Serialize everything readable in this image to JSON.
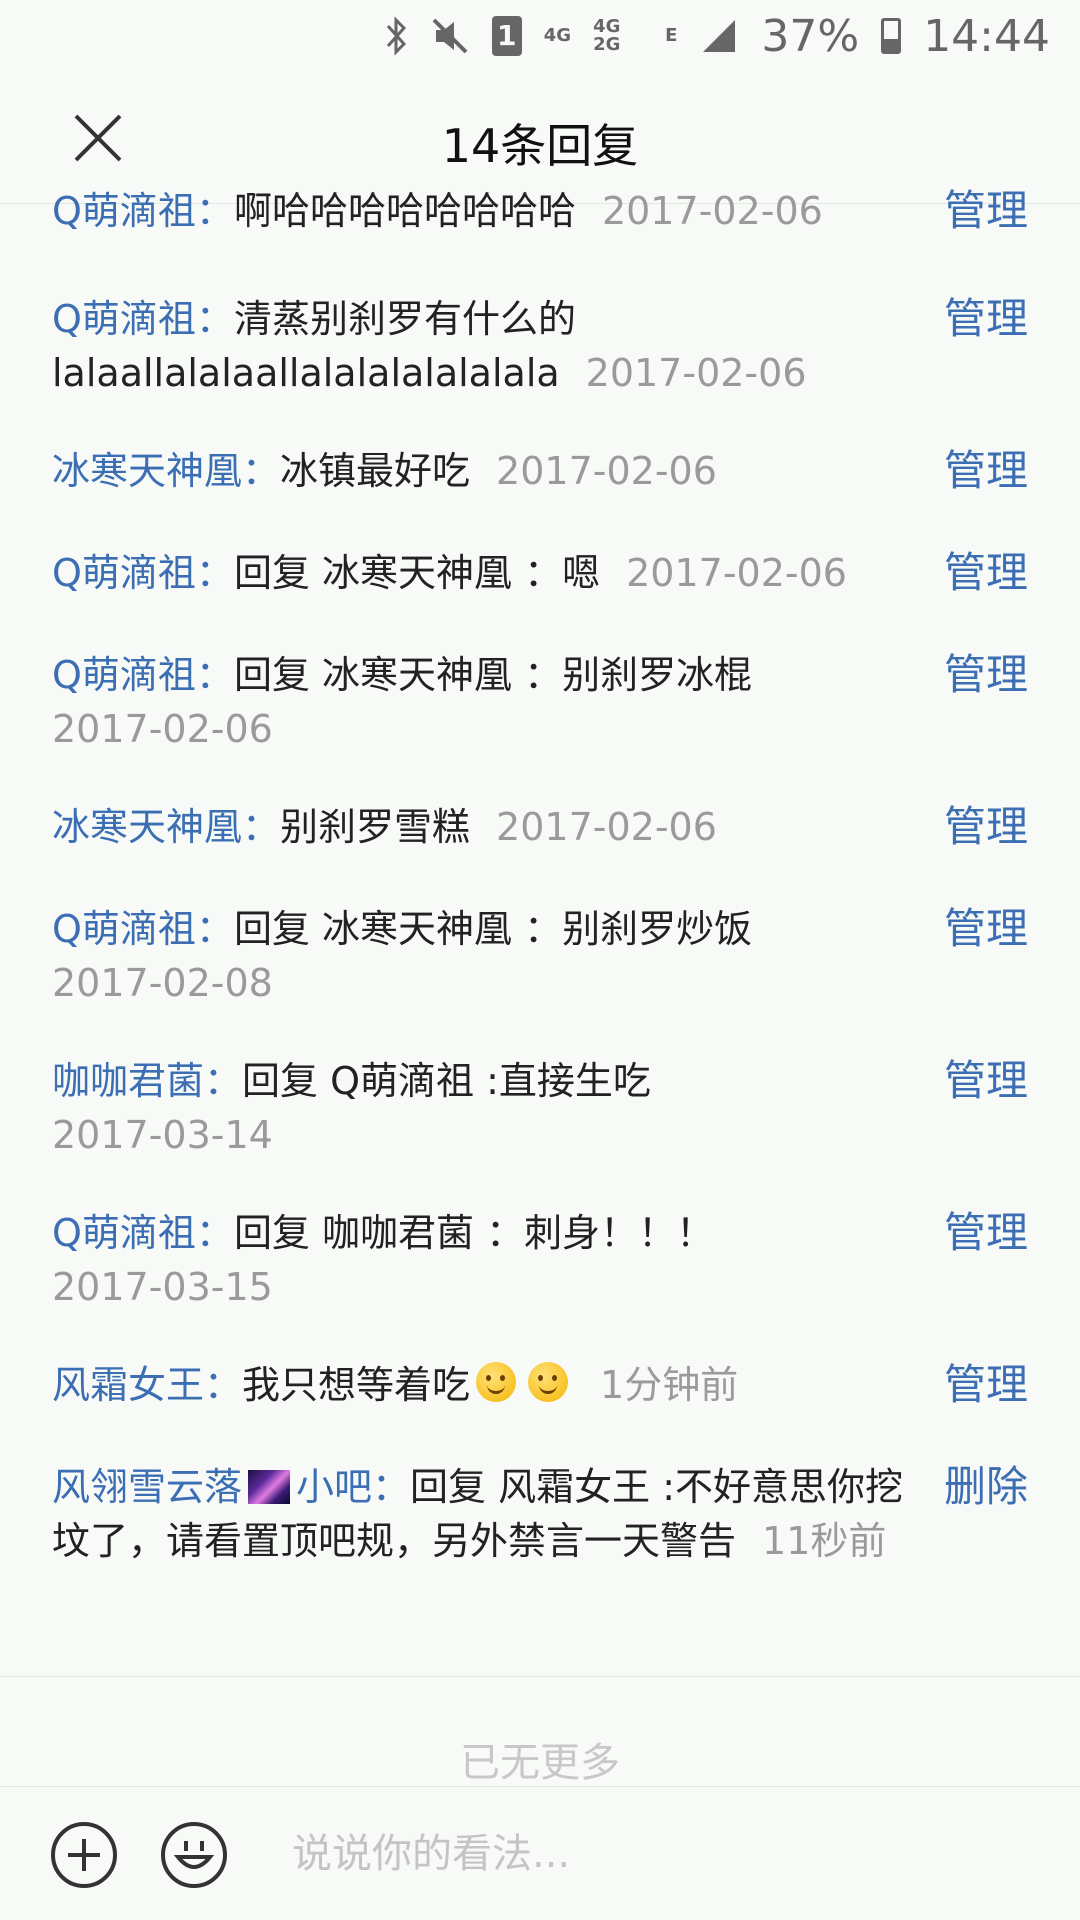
{
  "status_bar": {
    "sim_slot": "1",
    "network_a": "4G",
    "network_b": "4G 2G",
    "network_c": "E",
    "battery": "37%",
    "time": "14:44"
  },
  "header": {
    "title": "14条回复"
  },
  "replies": [
    {
      "user": "Q萌滴祖",
      "sep": "：",
      "content": "啊哈哈哈哈哈哈哈哈",
      "time": "2017-02-06",
      "action": "管理"
    },
    {
      "user": "Q萌滴祖",
      "sep": "：",
      "content": "清蒸别刹罗有什么的 lalaallalalaallalalalalalalala",
      "time": "2017-02-06",
      "action": "管理"
    },
    {
      "user": "冰寒天神凰",
      "sep": "：",
      "content": "冰镇最好吃",
      "time": "2017-02-06",
      "action": "管理"
    },
    {
      "user": "Q萌滴祖",
      "sep": "：",
      "content": "回复 冰寒天神凰 ：嗯",
      "time": "2017-02-06",
      "action": "管理"
    },
    {
      "user": "Q萌滴祖",
      "sep": "：",
      "content": "回复 冰寒天神凰 ：别刹罗冰棍",
      "time": "2017-02-06",
      "action": "管理"
    },
    {
      "user": "冰寒天神凰",
      "sep": "：",
      "content": "别刹罗雪糕",
      "time": "2017-02-06",
      "action": "管理"
    },
    {
      "user": "Q萌滴祖",
      "sep": "：",
      "content": "回复 冰寒天神凰 ：别刹罗炒饭",
      "time": "2017-02-08",
      "action": "管理"
    },
    {
      "user": "咖咖君菌",
      "sep": "：",
      "content": "回复 Q萌滴祖 :直接生吃",
      "time": "2017-03-14",
      "action": "管理"
    },
    {
      "user": "Q萌滴祖",
      "sep": "：",
      "content": "回复 咖咖君菌 ：刺身！！！",
      "time": "2017-03-15",
      "action": "管理"
    },
    {
      "user": "风霜女王",
      "sep": "：",
      "content": "我只想等着吃",
      "time": "1分钟前",
      "action": "管理"
    },
    {
      "user": "风翎雪云落",
      "badge": "小吧",
      "sep": "：",
      "content": "回复 风霜女王 :不好意思你挖坟了，请看置顶吧规，另外禁言一天警告",
      "time": "11秒前",
      "action": "删除"
    }
  ],
  "footer": {
    "no_more": "已无更多"
  },
  "bottom_bar": {
    "placeholder": "说说你的看法..."
  },
  "colors": {
    "link_blue": "#3c6eb4",
    "timestamp_gray": "#9a9a9a",
    "background": "#f7faf7"
  },
  "icons": [
    "bluetooth-icon",
    "mute-icon",
    "signal-icon",
    "battery-icon",
    "close-icon",
    "plus-circle-icon",
    "emoji-icon",
    "smiley-emoji-icon",
    "galaxy-badge-icon"
  ]
}
